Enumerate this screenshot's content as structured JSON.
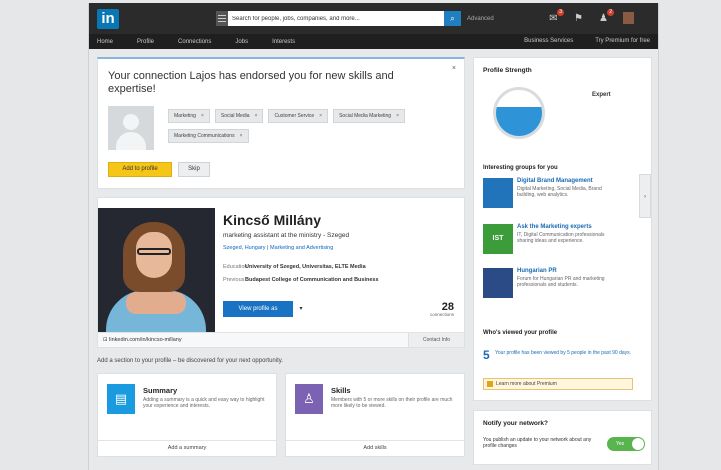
{
  "search": {
    "category_icon": "menu-icon",
    "value": "Search for people, jobs, companies, and more...",
    "button_icon": "search-icon",
    "advanced": "Advanced"
  },
  "topbar": {
    "logo": "in",
    "messages_badge": "3",
    "notifications_badge": "2",
    "icons": [
      "envelope-icon",
      "flag-icon",
      "person-add-icon",
      "avatar"
    ]
  },
  "nav": {
    "items": [
      "Home",
      "Profile",
      "Connections",
      "Jobs",
      "Interests"
    ],
    "right": [
      "Business Services",
      "Try Premium for free"
    ]
  },
  "endorse": {
    "title": "Your connection Lajos has endorsed you for new skills and expertise!",
    "close": "×",
    "skills": [
      "Marketing",
      "Social Media",
      "Customer Service",
      "Social Media Marketing",
      "Marketing Communications"
    ],
    "add_button": "Add to profile",
    "skip_button": "Skip"
  },
  "profile": {
    "name": "Kincső Millány",
    "headline": "marketing assistant at the ministry - Szeged",
    "location": "Szeged, Hungary",
    "industry": "Marketing and Advertising",
    "education_label": "Education",
    "education_value": "University of Szeged, Universitas, ELTE Media",
    "previous_label": "Previous",
    "previous_value": "Budapest College of Communication and Business",
    "view_button": "View profile as",
    "connections_count": "28",
    "connections_label": "connections",
    "url_text": "linkedin.com/in/kincso-millany",
    "contact": "Contact Info"
  },
  "add_sections": "Add a section to your profile – be discovered for your next opportunity.",
  "sections": [
    {
      "title": "Summary",
      "desc": "Adding a summary is a quick and easy way to highlight your experience and interests.",
      "button": "Add a summary",
      "icon": "document-icon",
      "color": "#1a9be0"
    },
    {
      "title": "Skills",
      "desc": "Members with 5 or more skills on their profile are much more likely to be viewed.",
      "button": "Add skills",
      "icon": "person-icon",
      "color": "#7b62b3"
    }
  ],
  "strength": {
    "title": "Profile Strength",
    "level": "Expert",
    "fill_fraction": 0.62
  },
  "interests": {
    "title": "Interesting groups for you",
    "groups": [
      {
        "name": "Digital Brand Management",
        "desc": "Digital Marketing, Social Media, Brand building, web analytics.",
        "thumb": "",
        "color": "#2174ba"
      },
      {
        "name": "Ask the Marketing experts",
        "desc": "IT, Digital Communication professionals sharing ideas and experience.",
        "thumb": "IST",
        "color": "#3c9c3a"
      },
      {
        "name": "Hungarian PR",
        "desc": "Forum for Hungarian PR and marketing professionals and students.",
        "thumb": "",
        "color": "#2b4b86"
      }
    ]
  },
  "viewed": {
    "title": "Who's viewed your profile",
    "count": "5",
    "text": "Your profile has been viewed by 5 people in the past 90 days."
  },
  "premium": "Learn more about Premium",
  "notify": {
    "title": "Notify your network?",
    "text": "You publish an update to your network about any profile changes",
    "toggle": "Yes"
  }
}
